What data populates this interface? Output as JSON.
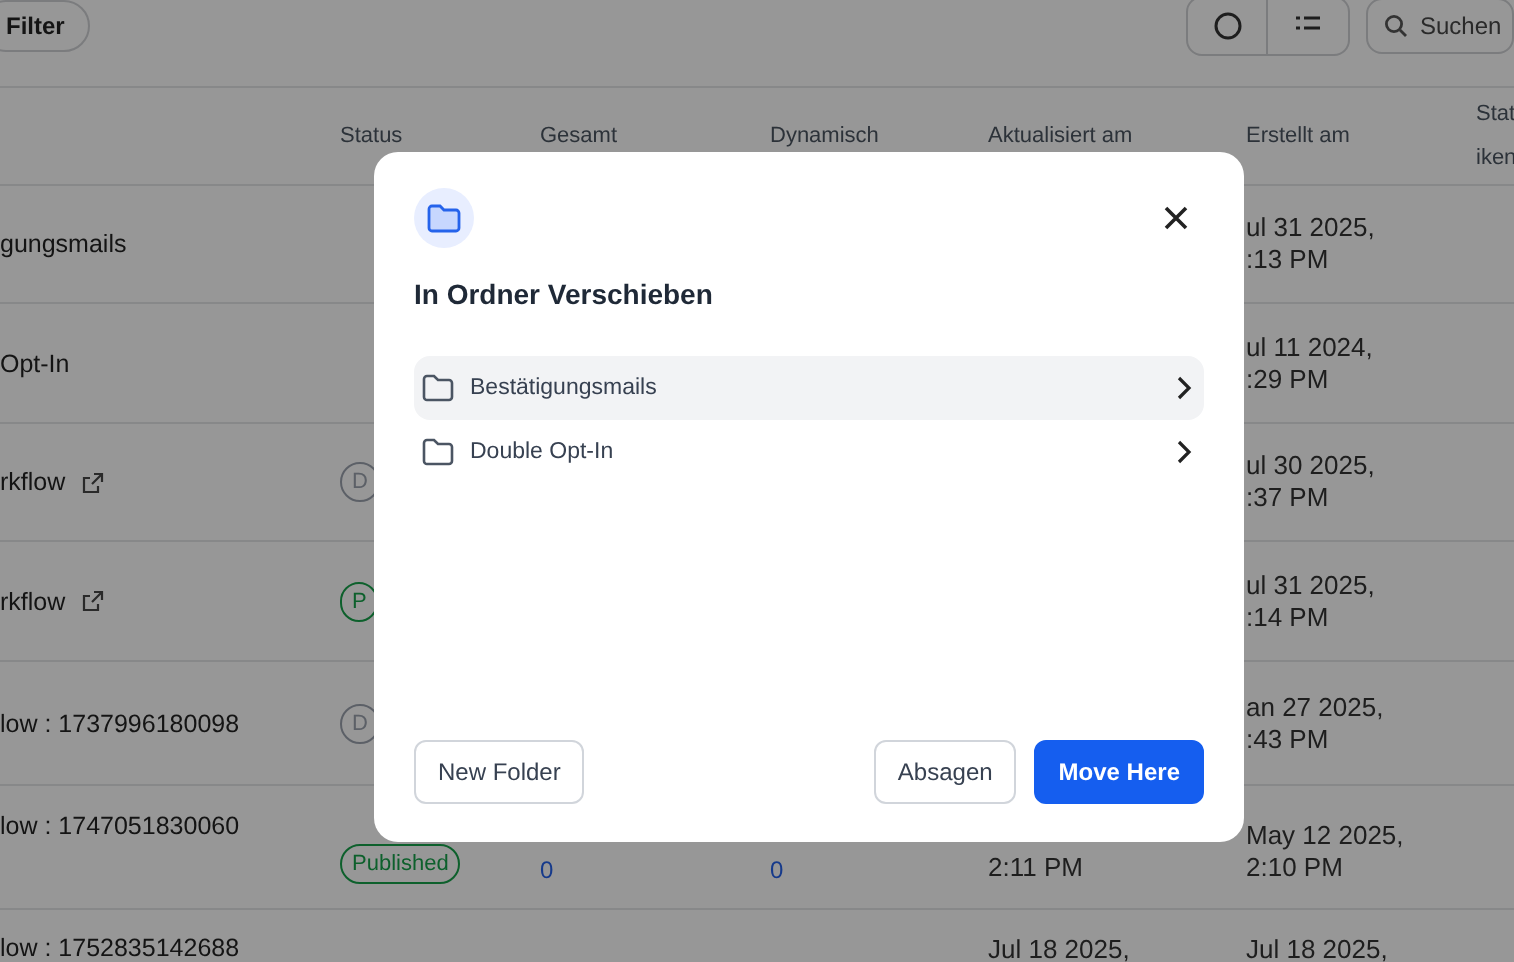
{
  "toolbar": {
    "filter_button": "Filter",
    "search": {
      "placeholder": "Suchen"
    }
  },
  "table": {
    "columns": [
      {
        "lines": [
          "Status"
        ]
      },
      {
        "lines": [
          "Gesamt"
        ]
      },
      {
        "lines": [
          "Dynamisch"
        ]
      },
      {
        "lines": [
          "Aktualisiert am"
        ]
      },
      {
        "lines": [
          "Erstellt am"
        ]
      },
      {
        "lines": [
          "Stat",
          "iken"
        ]
      }
    ],
    "rows": [
      {
        "name": "gungsmails",
        "link": false,
        "status": null,
        "gesamt": "",
        "dynamisch": "",
        "updated": [],
        "created": [
          "ul 31 2025,",
          ":13 PM"
        ]
      },
      {
        "name": "Opt-In",
        "link": false,
        "status": null,
        "gesamt": "",
        "dynamisch": "",
        "updated": [],
        "created": [
          "ul 11 2024,",
          ":29 PM"
        ]
      },
      {
        "name": "rkflow",
        "link": true,
        "status": {
          "label": "D",
          "color": "#5c6067"
        },
        "gesamt": "",
        "dynamisch": "",
        "updated": [],
        "created": [
          "ul 30 2025,",
          ":37 PM"
        ]
      },
      {
        "name": "rkflow",
        "link": true,
        "status": {
          "label": "P",
          "color": "#0d602c"
        },
        "gesamt": "",
        "dynamisch": "",
        "updated": [],
        "created": [
          "ul 31 2025,",
          ":14 PM"
        ]
      },
      {
        "name": "low : 1737996180098",
        "link": false,
        "status": {
          "label": "D",
          "color": "#5c6067"
        },
        "gesamt": "",
        "dynamisch": "",
        "updated": [],
        "created": [
          "an 27 2025,",
          ":43 PM"
        ]
      },
      {
        "name": "low : 1747051830060",
        "link": false,
        "status": {
          "label": "Published",
          "color": "#0d602c"
        },
        "gesamt": "0",
        "dynamisch": "0",
        "updated": [
          "2:11 PM"
        ],
        "created": [
          "May 12 2025,",
          "2:10 PM"
        ]
      },
      {
        "name": "low : 1752835142688",
        "link": false,
        "status": null,
        "gesamt": "",
        "dynamisch": "",
        "updated": [
          "Jul 18 2025,"
        ],
        "created": [
          "Jul 18 2025,"
        ]
      }
    ]
  },
  "dialog": {
    "title": "In Ordner Verschieben",
    "folders": [
      {
        "name": "Bestätigungsmails",
        "selected": true
      },
      {
        "name": "Double Opt-In",
        "selected": false
      }
    ],
    "buttons": {
      "new_folder": "New Folder",
      "cancel": "Absagen",
      "confirm": "Move Here"
    }
  }
}
